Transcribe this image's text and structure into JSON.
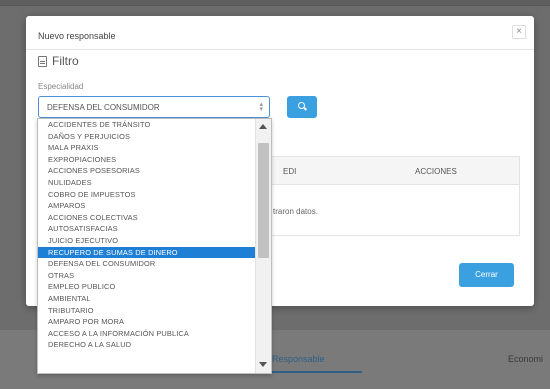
{
  "background": {
    "tabs": {
      "responsable": "Responsable",
      "economico": "Economi"
    }
  },
  "modal": {
    "title": "Nuevo responsable",
    "close_label": "×",
    "filter_title": "Filtro",
    "field_label": "Especialidad",
    "select_value": "DEFENSA DEL CONSUMIDOR",
    "table": {
      "col_edi": "EDI",
      "col_acciones": "ACCIONES",
      "empty_msg": "traron datos."
    },
    "close_button": "Cerrar"
  },
  "dropdown": {
    "options": [
      "ACCIDENTES DE TRÁNSITO",
      "DAÑOS Y PERJUICIOS",
      "MALA PRAXIS",
      "EXPROPIACIONES",
      "ACCIONES POSESORIAS",
      "NULIDADES",
      "COBRO DE IMPUESTOS",
      "AMPAROS",
      "ACCIONES COLECTIVAS",
      "AUTOSATISFACIAS",
      "JUICIO EJECUTIVO",
      "RECUPERO DE SUMAS DE DINERO",
      "DEFENSA DEL CONSUMIDOR",
      "OTRAS",
      "EMPLEO PUBLICO",
      "AMBIENTAL",
      "TRIBUTARIO",
      "AMPARO POR MORA",
      "ACCESO A LA INFORMACIÓN PUBLICA",
      "DERECHO A LA SALUD"
    ],
    "selected_index": 11
  },
  "colors": {
    "accent": "#3aa0e0",
    "selected": "#1e7fd6"
  },
  "icons": {
    "filter": "document-icon",
    "search": "search-icon",
    "close": "close-icon"
  }
}
